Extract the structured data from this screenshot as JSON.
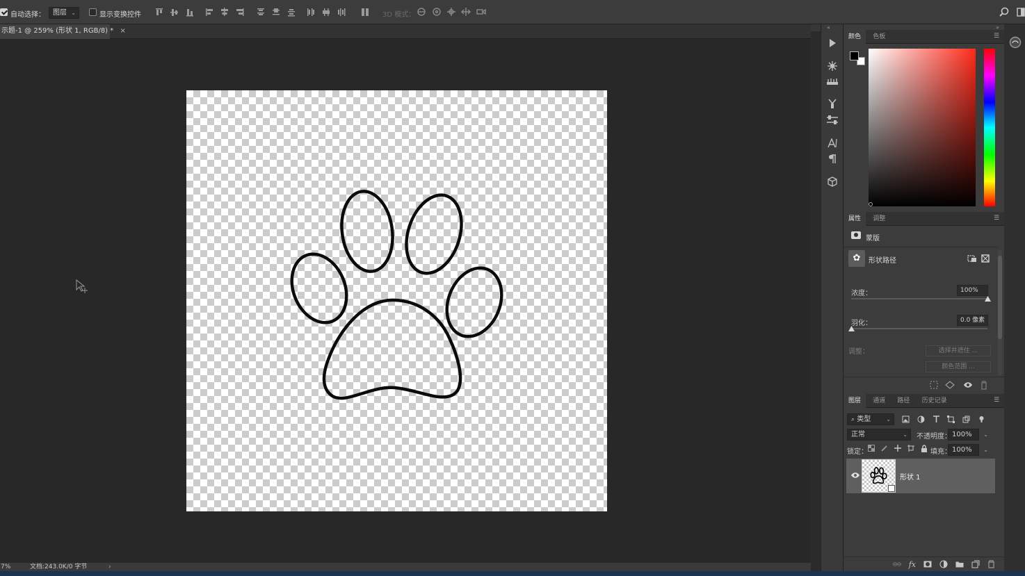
{
  "options_bar": {
    "auto_select_label": "自动选择：",
    "auto_select_value": "图层",
    "show_transform_label": "显示变换控件",
    "mode_3d_label": "3D 模式："
  },
  "document": {
    "tab_title": "示题-1 @ 259% (形状 1, RGB/8) *",
    "close_glyph": "×",
    "zoom_text": "7%",
    "doc_info": "文档:243.0K/0 字节",
    "status_arrow": "›"
  },
  "color_panel": {
    "tabs": [
      "颜色",
      "色板"
    ],
    "foreground": "#000000",
    "background": "#ffffff",
    "hue_color": "#ff2a1a"
  },
  "properties_panel": {
    "tabs": [
      "属性",
      "调整"
    ],
    "mask_label": "蒙版",
    "shape_path_label": "形状路径",
    "density_label": "浓度：",
    "density_value": "100%",
    "density_level": 1.0,
    "feather_label": "羽化：",
    "feather_value": "0.0 像素",
    "feather_level": 0.0,
    "refine_label": "调整：",
    "select_mask_button": "选择并遮住 ...",
    "color_range_button": "颜色范围 ..."
  },
  "layers_panel": {
    "tabs": [
      "图层",
      "通道",
      "路径",
      "历史记录"
    ],
    "filter_kind": "类型",
    "blend_mode": "正常",
    "opacity_label": "不透明度：",
    "opacity_value": "100%",
    "lock_label": "锁定：",
    "fill_label": "填充：",
    "fill_value": "100%",
    "layers": [
      {
        "name": "形状 1",
        "visible": true
      }
    ]
  },
  "icons": {
    "tool_strip": [
      "play-icon",
      "brush-settings-icon",
      "brush-presets-icon",
      "clone-source-icon",
      "adjust-sliders-icon",
      "character-icon",
      "paragraph-icon",
      "3d-cube-icon"
    ]
  }
}
